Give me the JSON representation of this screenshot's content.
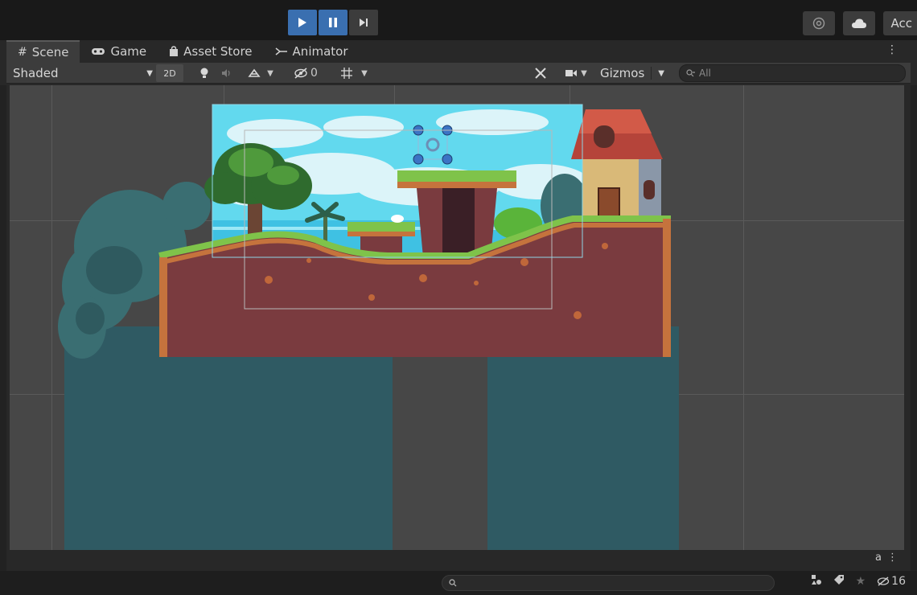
{
  "toolbar": {
    "account_label": "Acc"
  },
  "tabs": [
    {
      "label": "Scene",
      "icon": "grid-icon"
    },
    {
      "label": "Game",
      "icon": "gamepad-icon"
    },
    {
      "label": "Asset Store",
      "icon": "bag-icon"
    },
    {
      "label": "Animator",
      "icon": "animator-icon"
    }
  ],
  "scene_toolbar": {
    "shading_mode": "Shaded",
    "mode_2d": "2D",
    "hidden_count": "0",
    "gizmos_label": "Gizmos",
    "search_placeholder": "All"
  },
  "statusbar": {
    "hidden_objects": "16"
  },
  "colors": {
    "play_active": "#3a6fb0",
    "sky": "#62d9ee",
    "dirt": "#7a3b3f",
    "grass": "#7fc34a",
    "teal": "#2f5a63"
  }
}
